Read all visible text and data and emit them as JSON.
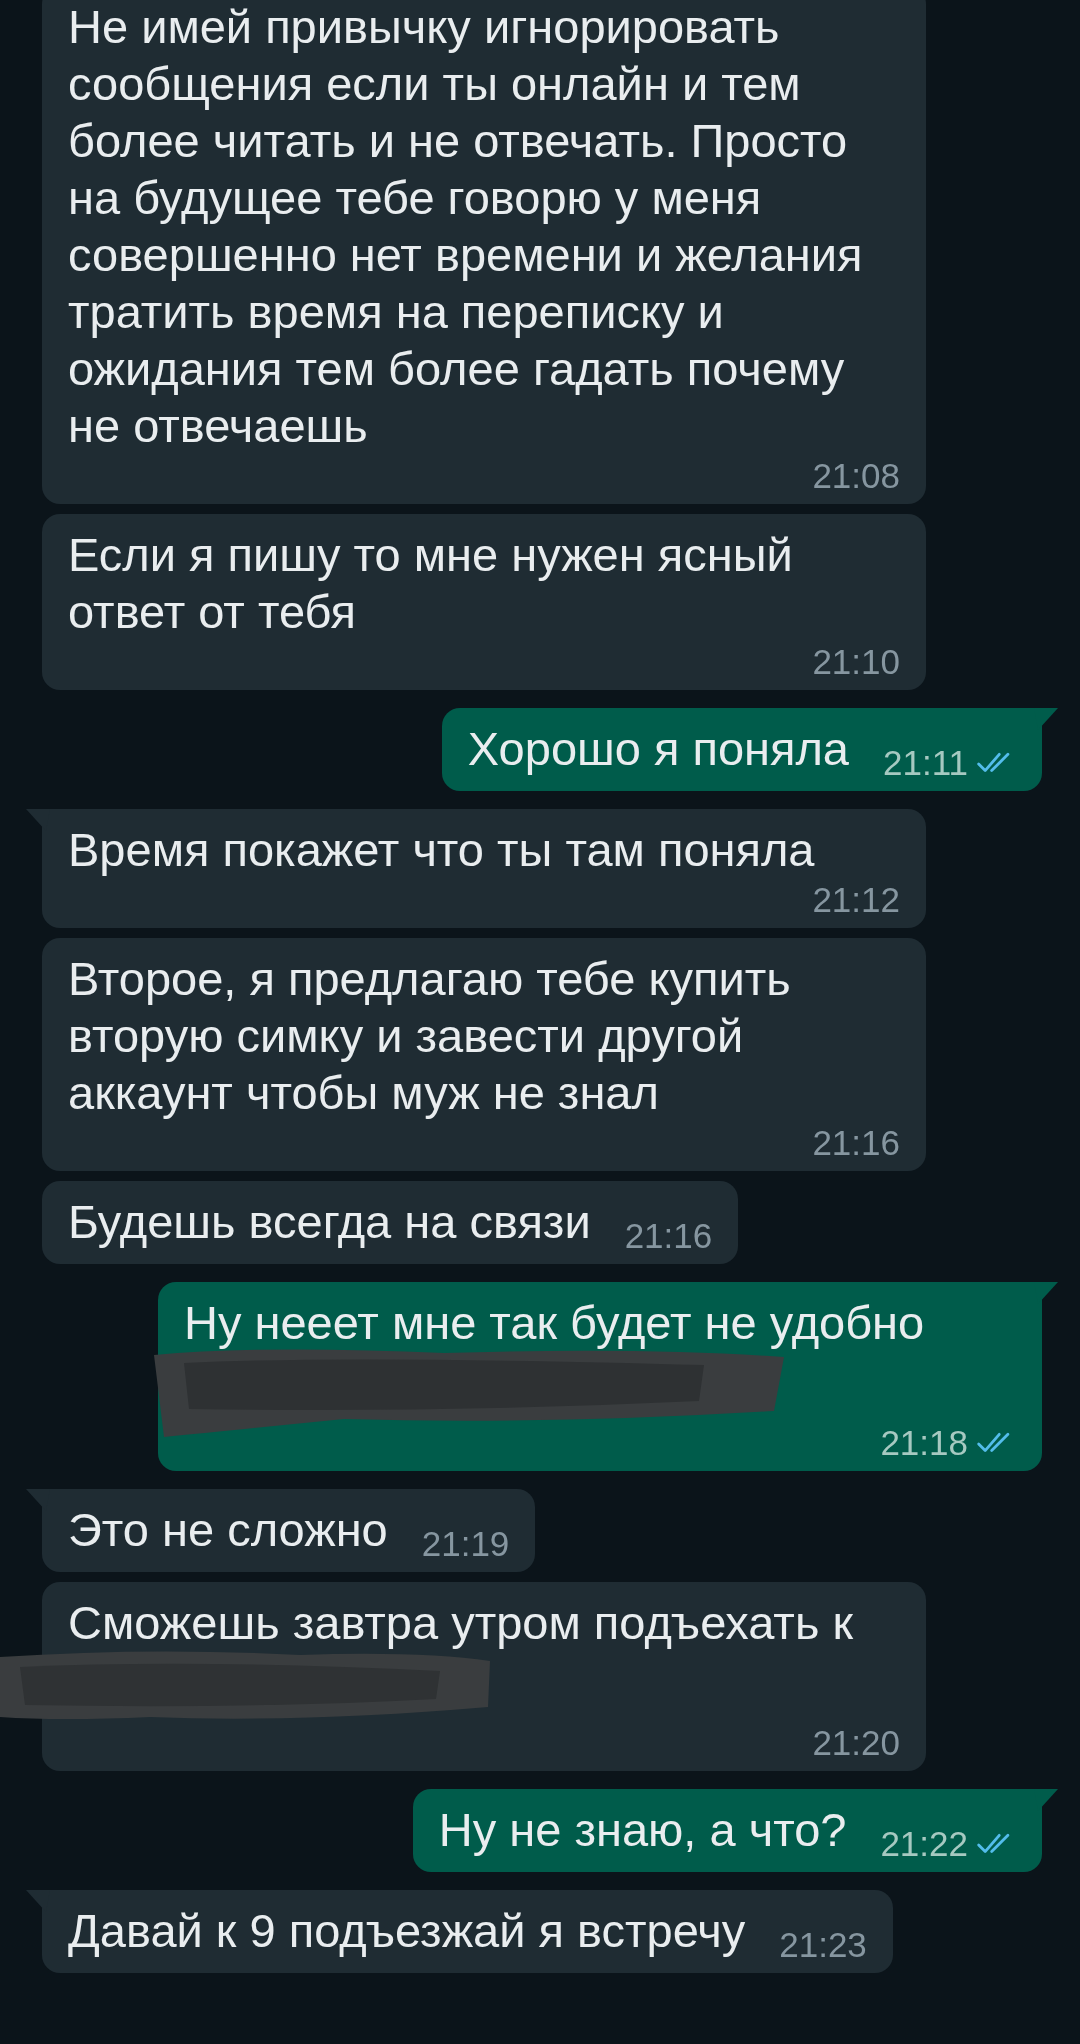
{
  "messages": [
    {
      "kind": "incoming",
      "text": "Не имей привычку игнорировать сообщения если ты онлайн и тем более читать и не отвечать. Просто на будущее тебе говорю у меня совершенно нет времени и желания тратить время на переписку и ожидания тем более гадать почему не отвечаешь",
      "time": "21:08",
      "tail": false,
      "redacted": false
    },
    {
      "kind": "incoming",
      "text": "Если я пишу то мне нужен ясный ответ от тебя",
      "time": "21:10",
      "tail": false,
      "redacted": false
    },
    {
      "kind": "outgoing",
      "text": "Хорошо я поняла",
      "time": "21:11",
      "tail": true,
      "redacted": false,
      "read": true
    },
    {
      "kind": "incoming",
      "text": "Время покажет что ты там поняла",
      "time": "21:12",
      "tail": true,
      "redacted": false
    },
    {
      "kind": "incoming",
      "text": "Второе, я предлагаю тебе купить вторую симку и завести другой аккаунт чтобы муж не знал",
      "time": "21:16",
      "tail": false,
      "redacted": false
    },
    {
      "kind": "incoming",
      "text": "Будешь всегда на связи",
      "time": "21:16",
      "tail": false,
      "redacted": false
    },
    {
      "kind": "outgoing",
      "text": "Ну нееет мне так будет не удобно",
      "time": "21:18",
      "tail": true,
      "redacted": true,
      "read": true
    },
    {
      "kind": "incoming",
      "text": "Это не сложно",
      "time": "21:19",
      "tail": true,
      "redacted": false
    },
    {
      "kind": "incoming",
      "text": "Сможешь завтра утром подъехать к",
      "time": "21:20",
      "tail": false,
      "redacted": true
    },
    {
      "kind": "outgoing",
      "text": "Ну не знаю, а что?",
      "time": "21:22",
      "tail": true,
      "redacted": false,
      "read": true
    },
    {
      "kind": "incoming",
      "text": "Давай к 9 подъезжай я встречу",
      "time": "21:23",
      "tail": true,
      "redacted": false
    }
  ]
}
